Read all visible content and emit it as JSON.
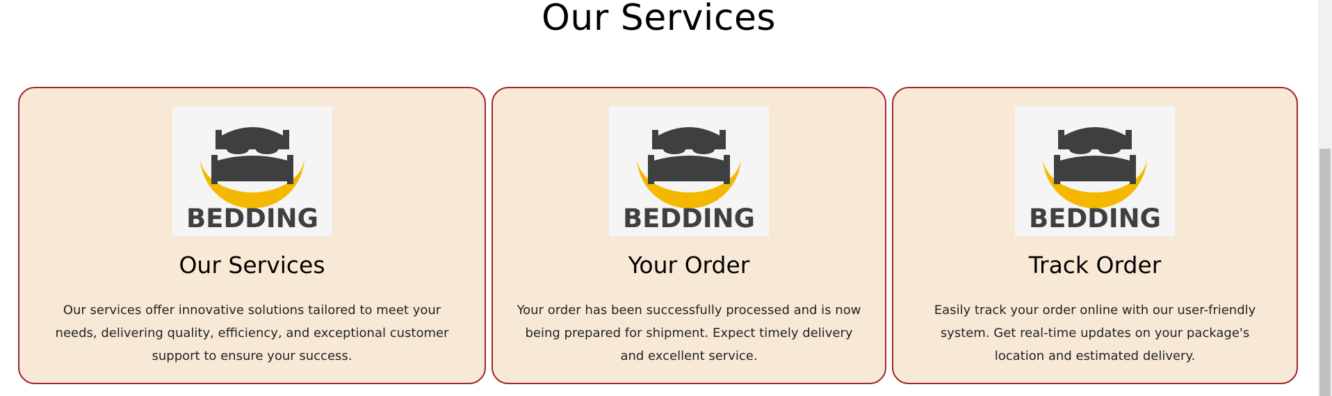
{
  "section": {
    "title": "Our Services"
  },
  "cards": [
    {
      "logo_text": "BEDDING",
      "title": "Our Services",
      "description": "Our services offer innovative solutions tailored to meet your needs, delivering quality, efficiency, and exceptional customer support to ensure your success."
    },
    {
      "logo_text": "BEDDING",
      "title": "Your Order",
      "description": "Your order has been successfully processed and is now being prepared for shipment. Expect timely delivery and excellent service."
    },
    {
      "logo_text": "BEDDING",
      "title": "Track Order",
      "description": "Easily track your order online with our user-friendly system. Get real-time updates on your package's location and estimated delivery."
    }
  ],
  "icons": {
    "logo": "bedding-logo-icon"
  },
  "colors": {
    "card_background": "#f8e9d6",
    "card_border": "#a3262b",
    "logo_dark": "#3d3f40",
    "logo_accent": "#f5b800"
  }
}
